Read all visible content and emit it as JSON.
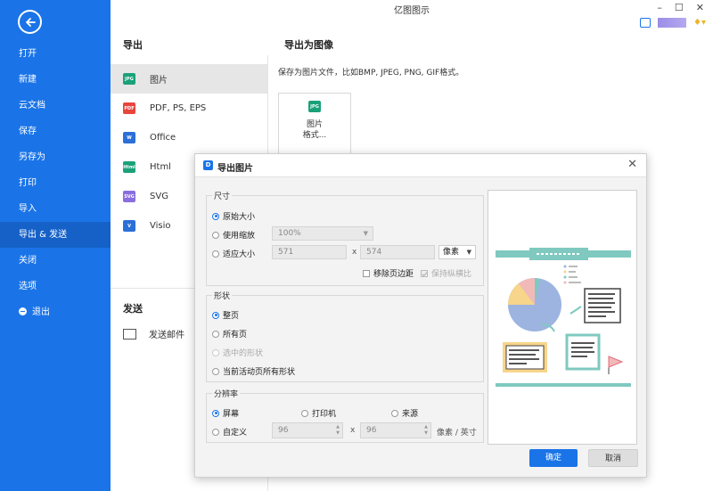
{
  "app": {
    "title": "亿图图示"
  },
  "sidebar": {
    "items": [
      {
        "label": "打开"
      },
      {
        "label": "新建"
      },
      {
        "label": "云文档"
      },
      {
        "label": "保存"
      },
      {
        "label": "另存为"
      },
      {
        "label": "打印"
      },
      {
        "label": "导入"
      },
      {
        "label": "导出 & 发送",
        "active": true
      },
      {
        "label": "关闭"
      },
      {
        "label": "选项"
      },
      {
        "label": "退出"
      }
    ]
  },
  "export_panel": {
    "title": "导出",
    "formats": [
      {
        "label": "图片",
        "icon": "JPG",
        "color": "#1aa179",
        "active": true
      },
      {
        "label": "PDF, PS, EPS",
        "icon": "PDF",
        "color": "#e8453c"
      },
      {
        "label": "Office",
        "icon": "W",
        "color": "#2b6fd8"
      },
      {
        "label": "Html",
        "icon": "Html",
        "color": "#1aa179"
      },
      {
        "label": "SVG",
        "icon": "SVG",
        "color": "#8a6ee0"
      },
      {
        "label": "Visio",
        "icon": "V",
        "color": "#2b6fd8"
      }
    ],
    "send_title": "发送",
    "send_mail": "发送邮件"
  },
  "image_export": {
    "title": "导出为图像",
    "description": "保存为图片文件，比如BMP, JPEG, PNG, GIF格式。",
    "card_icon": "JPG",
    "card_line1": "图片",
    "card_line2": "格式..."
  },
  "dialog": {
    "title": "导出图片",
    "size": {
      "label": "尺寸",
      "original": "原始大小",
      "use_zoom": "使用缩放",
      "zoom_value": "100%",
      "fit_size": "适应大小",
      "width": "571",
      "height": "574",
      "x": "x",
      "unit": "像素",
      "remove_margin": "移除页边距",
      "keep_ratio": "保持纵横比"
    },
    "shape": {
      "label": "形状",
      "whole_page": "整页",
      "all_pages": "所有页",
      "selected": "选中的形状",
      "current_page_all": "当前活动页所有形状"
    },
    "resolution": {
      "label": "分辨率",
      "screen": "屏幕",
      "printer": "打印机",
      "source": "来源",
      "custom": "自定义",
      "dpi_x": "96",
      "dpi_y": "96",
      "x": "x",
      "unit": "像素 / 英寸"
    },
    "ok": "确定",
    "cancel": "取消"
  },
  "colors": {
    "accent": "#1a74e8",
    "teal": "#7fc9c0",
    "pie_blue": "#9db4e0",
    "pie_yellow": "#f7d58a",
    "pie_pink": "#f2b9b9"
  }
}
